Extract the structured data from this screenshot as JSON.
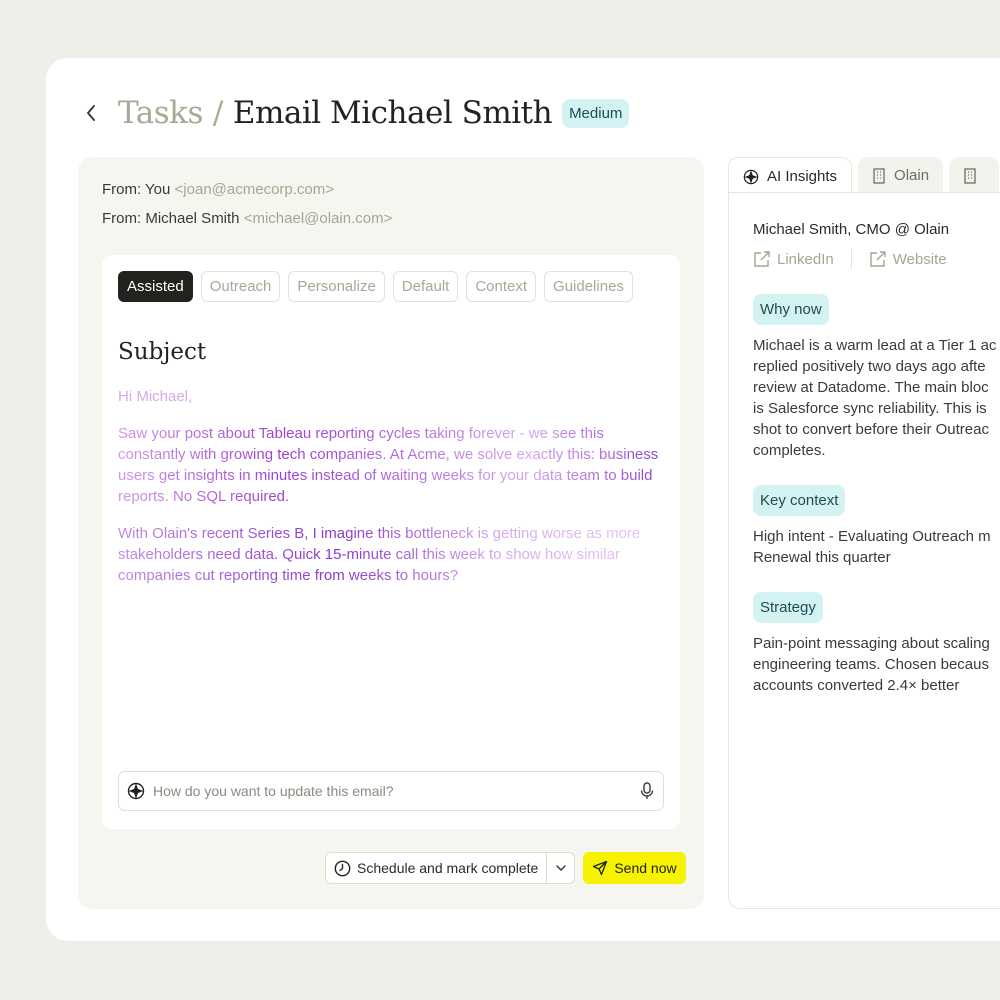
{
  "header": {
    "breadcrumb_parent": "Tasks",
    "breadcrumb_separator": "/",
    "title": "Email Michael Smith",
    "priority_badge": "Medium"
  },
  "email": {
    "from_you_label": "From: You",
    "from_you_addr": "<joan@acmecorp.com>",
    "from_contact_label": "From: Michael Smith",
    "from_contact_addr": "<michael@olain.com>",
    "chips": [
      "Assisted",
      "Outreach",
      "Personalize",
      "Default",
      "Context",
      "Guidelines"
    ],
    "active_chip": "Assisted",
    "subject": "Subject",
    "greeting": "Hi Michael,",
    "paragraph1": "Saw your post about Tableau reporting cycles taking forever - we see this constantly with growing tech companies. At Acme, we solve exactly this: business users get insights in minutes instead of waiting weeks for your data team to build reports. No SQL required.",
    "paragraph2": "With Olain's recent Series B, I imagine this bottleneck is getting worse as more stakeholders need data. Quick 15-minute call this week to show how similar companies cut reporting time from weeks to hours?",
    "prompt_placeholder": "How do you want to update this email?",
    "schedule_label": "Schedule and mark complete",
    "send_label": "Send now"
  },
  "insights": {
    "tabs": [
      "AI Insights",
      "Olain",
      ""
    ],
    "person": "Michael Smith, CMO @ Olain",
    "linkedin_label": "LinkedIn",
    "website_label": "Website",
    "why_now_label": "Why now",
    "why_now_text": "Michael is a warm lead at a Tier 1 ac\nreplied positively two days ago afte\nreview at Datadome. The main bloc\nis Salesforce sync reliability. This is\nshot to convert before their Outreac\ncompletes.",
    "key_context_label": "Key context",
    "key_context_text": "High intent - Evaluating Outreach m\nRenewal this quarter",
    "strategy_label": "Strategy",
    "strategy_text": "Pain-point messaging about scaling\nengineering teams. Chosen becaus\naccounts converted 2.4× better"
  },
  "colors": {
    "accent_badge": "#d3f3f3",
    "send_button": "#f6f200",
    "active_chip": "#22221f",
    "ai_text": "#9c3fd1"
  },
  "icons": {
    "back": "chevron-left-icon",
    "ai": "ai-sparkle-icon",
    "mic": "microphone-icon",
    "clock": "clock-icon",
    "send": "paper-plane-icon",
    "building": "building-icon",
    "external_link": "external-link-icon"
  }
}
